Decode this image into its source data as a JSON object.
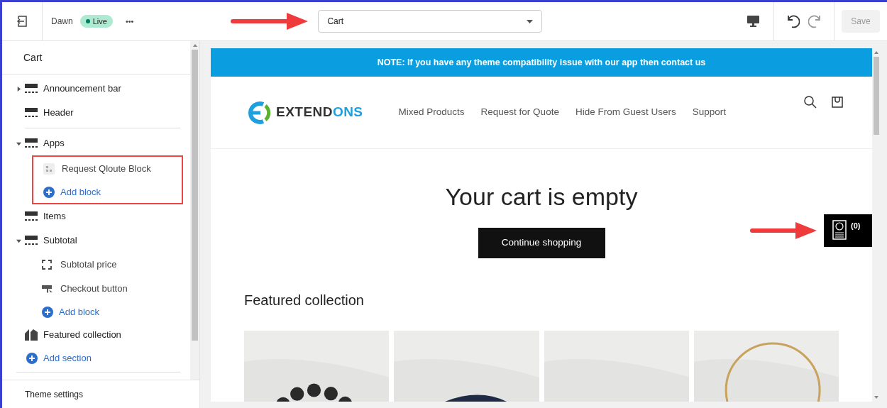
{
  "topbar": {
    "theme_name": "Dawn",
    "status_badge": "Live",
    "more_label": "•••",
    "template_select": {
      "value": "Cart"
    },
    "save_button": {
      "label": "Save",
      "disabled": true
    }
  },
  "sidebar": {
    "title": "Cart",
    "items": [
      {
        "kind": "section",
        "label": "Announcement bar",
        "expanded": false
      },
      {
        "kind": "section",
        "label": "Header",
        "divider_after": true
      },
      {
        "kind": "section",
        "label": "Apps",
        "expanded": true,
        "highlight_children": true,
        "children": [
          {
            "kind": "block",
            "label": "Request Qloute Block"
          },
          {
            "kind": "add",
            "label": "Add block"
          }
        ]
      },
      {
        "kind": "section",
        "label": "Items"
      },
      {
        "kind": "section",
        "label": "Subtotal",
        "expanded": true,
        "children": [
          {
            "kind": "block",
            "label": "Subtotal price"
          },
          {
            "kind": "block",
            "label": "Checkout button"
          },
          {
            "kind": "add",
            "label": "Add block"
          }
        ]
      },
      {
        "kind": "section",
        "label": "Featured collection"
      },
      {
        "kind": "add_section",
        "label": "Add section"
      }
    ],
    "footer": "Theme settings"
  },
  "preview": {
    "notice": "NOTE: If you have any theme compatibility issue with our app then contact us",
    "logo": {
      "word_dark": "EXTEND",
      "word_accent": "ONS"
    },
    "nav": [
      "Mixed Products",
      "Request for Quote",
      "Hide From Guest Users",
      "Support"
    ],
    "heading": "Your cart is empty",
    "button": "Continue shopping",
    "quote_widget": {
      "count": "(0)"
    },
    "featured_title": "Featured collection"
  }
}
